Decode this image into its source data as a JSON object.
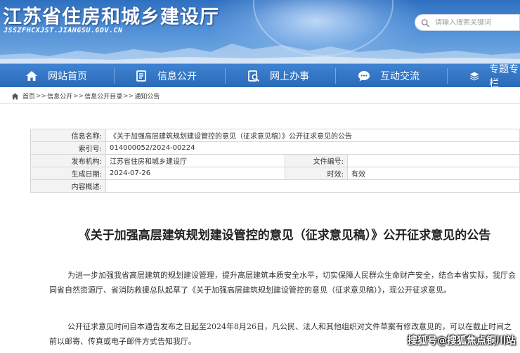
{
  "header": {
    "site_title": "江苏省住房和城乡建设厅",
    "site_url": "JSSZFHCXJST.JIANGSU.GOV.CN",
    "search_placeholder": "请输入搜索关键词"
  },
  "nav": {
    "items": [
      {
        "label": "网站首页",
        "icon": "home-icon"
      },
      {
        "label": "信息公开",
        "icon": "document-icon"
      },
      {
        "label": "网上办事",
        "icon": "search-doc-icon"
      },
      {
        "label": "互动交流",
        "icon": "chat-icon"
      },
      {
        "label": "专题专栏",
        "icon": "layers-icon"
      }
    ]
  },
  "breadcrumb": {
    "items": [
      "首页",
      "信息公开",
      "信息公开目录",
      "通知公告"
    ],
    "separator": ">>"
  },
  "meta": {
    "info_name_label": "信息名称:",
    "info_name_value": "《关于加强高层建筑规划建设管控的意见（征求意见稿）》公开征求意见的公告",
    "index_label": "索引号:",
    "index_value": "014000052/2024-00224",
    "publisher_label": "发布机构:",
    "publisher_value": "江苏省住房和城乡建设厅",
    "doc_no_label": "文件编号:",
    "doc_no_value": "",
    "date_label": "生成日期:",
    "date_value": "2024-07-26",
    "validity_label": "时效:",
    "validity_value": "有效",
    "summary_label": "内容概述:",
    "summary_value": ""
  },
  "article": {
    "title": "《关于加强高层建筑规划建设管控的意见（征求意见稿）》公开征求意见的公告",
    "para1": "为进一步加强我省高层建筑的规划建设管理，提升高层建筑本质安全水平，切实保障人民群众生命财产安全，结合本省实际，我厅会同省自然资源厅、省消防救援总队起草了《关于加强高层建筑规划建设管控的意见（征求意见稿）》，现公开征求意见。",
    "para2": "公开征求意见时间自本通告发布之日起至2024年8月26日，凡公民、法人和其他组织对文件草案有修改意见的，可以在截止时间之前以邮寄、传真或电子邮件方式告知我厅。"
  },
  "watermark": "搜狐号@搜狐焦点铜川站",
  "colors": {
    "nav_bg": "#2a6ab8",
    "header_bg": "#4f8fd6",
    "label_bg": "#f3f3f3"
  }
}
